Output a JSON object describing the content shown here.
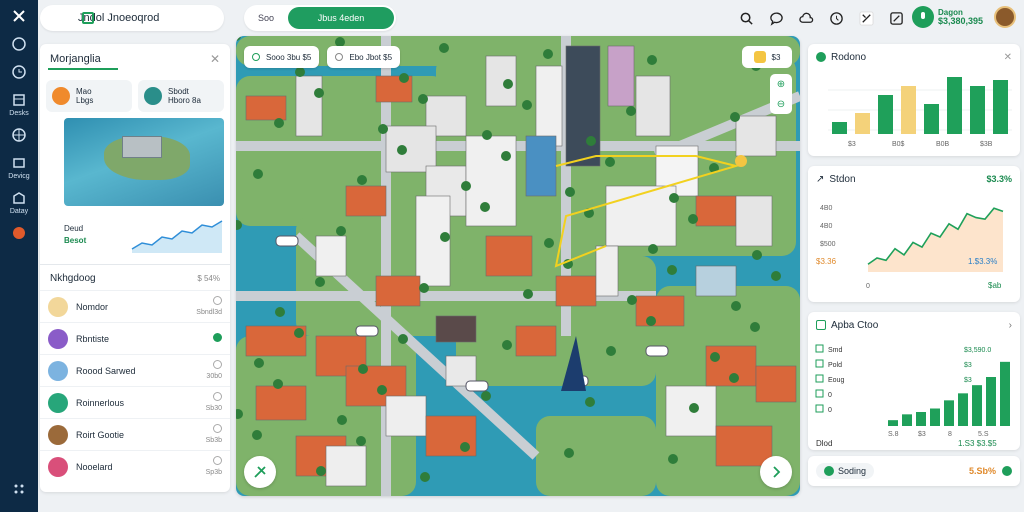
{
  "rail": {
    "items": [
      {
        "label": ""
      },
      {
        "label": ""
      },
      {
        "label": "Desks"
      },
      {
        "label": ""
      },
      {
        "label": "Devicg"
      },
      {
        "label": "Datay"
      }
    ]
  },
  "brand": {
    "title": "Jndol Jnoeoqrod"
  },
  "tabs": {
    "first": "Soo",
    "active": "Jbus 4eden"
  },
  "user": {
    "line1": "Dagon",
    "line2": "$3,380,395"
  },
  "left": {
    "title": "Morjanglia",
    "chips": [
      {
        "line1": "Mao",
        "line2": "Lbgs"
      },
      {
        "line1": "Sbodt",
        "line2": "Hboro 8a"
      }
    ],
    "stat": {
      "label": "Deud",
      "value": "Besot"
    },
    "section": {
      "title": "Nkhgdoog",
      "meta": "$ 54%"
    },
    "items": [
      {
        "name": "Nomdor",
        "meta": "Sbndl3d",
        "color": "#f2d79a"
      },
      {
        "name": "Rbntiste",
        "meta": "",
        "color": "#8a5cc8"
      },
      {
        "name": "Roood Sarwed",
        "meta": "30b0",
        "color": "#7cb3e0"
      },
      {
        "name": "Roinnerlous",
        "meta": "Sb30",
        "color": "#27a67a"
      },
      {
        "name": "Roirt Gootie",
        "meta": "Sb3b",
        "color": "#9b6a3a"
      },
      {
        "name": "Nooelard",
        "meta": "Sp3b",
        "color": "#d94f7a"
      }
    ]
  },
  "map": {
    "box1": "Sooo 3bu $5",
    "box2": "Ebo Jbot $5",
    "ctrl": "$3"
  },
  "cards": {
    "c1": {
      "title": "Rodono",
      "vals": [
        20,
        35,
        65,
        80,
        50,
        95,
        80,
        90
      ],
      "labels": [
        "$3",
        "B0$",
        "B0B",
        "$3B"
      ]
    },
    "c2": {
      "title": "Stdon",
      "pct": "$3.3%",
      "yl": [
        "4B0",
        "4B0",
        "$500"
      ],
      "note": "$3.36",
      "bval": "1.$3.3%",
      "bottom": "$ab",
      "series": [
        10,
        18,
        15,
        30,
        22,
        38,
        32,
        50,
        45,
        62,
        55,
        75,
        70,
        68,
        82,
        78
      ]
    },
    "c3": {
      "title": "Apba Ctoo",
      "rows": [
        {
          "k": "Smd",
          "v": "$3,590.0"
        },
        {
          "k": "Pold",
          "v": "$3"
        },
        {
          "k": "Eoug",
          "v": "$3"
        },
        {
          "k": "0",
          "v": ""
        },
        {
          "k": "0",
          "v": ""
        }
      ],
      "vals": [
        5,
        10,
        12,
        15,
        22,
        28,
        35,
        42,
        55
      ],
      "labels": [
        "S.8",
        "$3",
        "8",
        "5.S"
      ],
      "total_k": "Dlod",
      "total_v": "1.S3 $3.$5"
    },
    "foot": {
      "label": "Soding",
      "val": "5.Sb%"
    }
  },
  "colors": {
    "brand": "#1e9e5a",
    "rail": "#0d2a45",
    "water": "#2f9bb5"
  }
}
